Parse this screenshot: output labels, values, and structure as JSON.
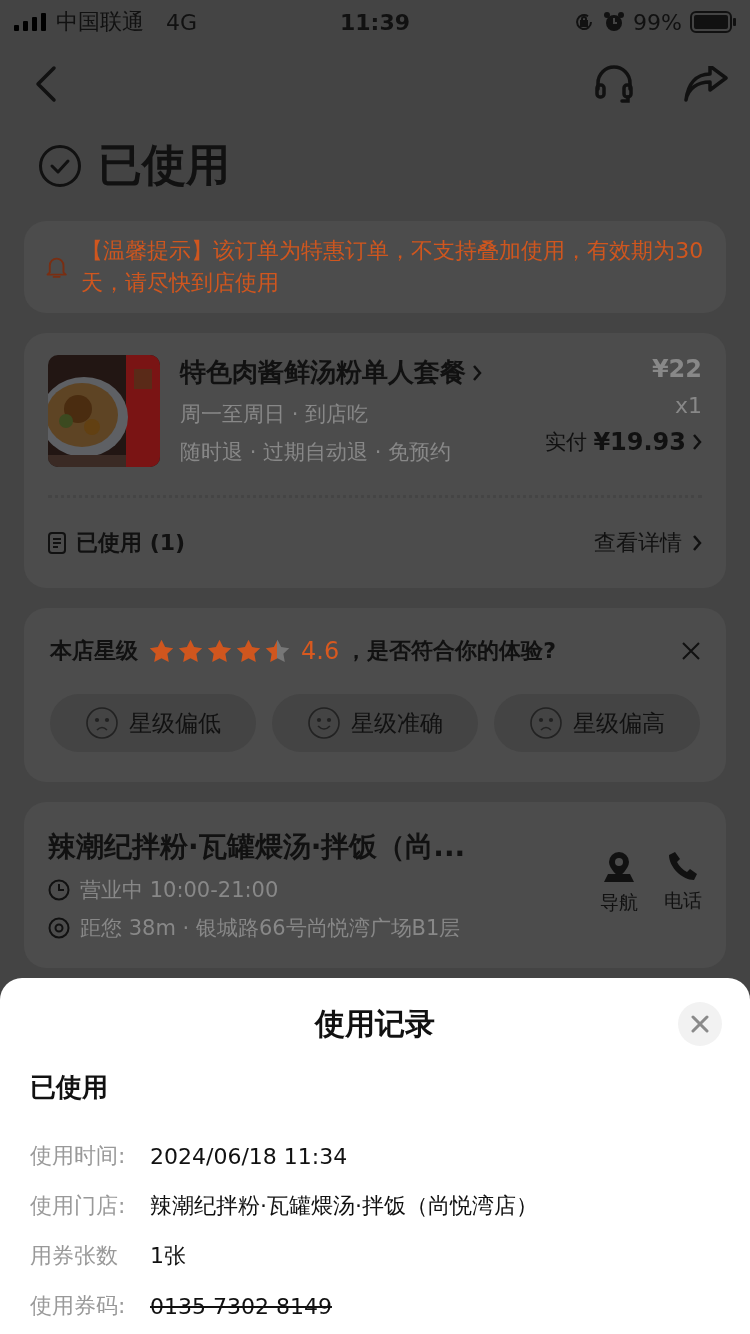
{
  "status_bar": {
    "carrier": "中国联通",
    "network": "4G",
    "time": "11:39",
    "battery": "99%"
  },
  "header": {
    "title": "已使用"
  },
  "notice": {
    "text": "【温馨提示】该订单为特惠订单，不支持叠加使用，有效期为30天，请尽快到店使用"
  },
  "product": {
    "name": "特色肉酱鲜汤粉单人套餐",
    "schedule": "周一至周日 · 到店吃",
    "policy": "随时退 · 过期自动退 · 免预约",
    "price": "¥22",
    "quantity": "x1",
    "paid_label": "实付",
    "paid": "¥19.93"
  },
  "usage": {
    "label": "已使用 (1)",
    "link": "查看详情"
  },
  "rating": {
    "label": "本店星级",
    "stars": 4.5,
    "score": "4.6",
    "question": "，是否符合你的体验?",
    "options": [
      {
        "label": "星级偏低",
        "kind": "sad"
      },
      {
        "label": "星级准确",
        "kind": "smile"
      },
      {
        "label": "星级偏高",
        "kind": "sad"
      }
    ]
  },
  "shop": {
    "name": "辣潮纪拌粉·瓦罐煨汤·拌饭（尚...",
    "hours": "营业中 10:00-21:00",
    "address": "距您 38m · 银城路66号尚悦湾广场B1层",
    "actions": [
      {
        "label": "导航",
        "kind": "nav"
      },
      {
        "label": "电话",
        "kind": "phone"
      }
    ]
  },
  "sheet": {
    "title": "使用记录",
    "status": "已使用",
    "fields": [
      {
        "label": "使用时间:",
        "value": "2024/06/18 11:34",
        "struck": false
      },
      {
        "label": "使用门店:",
        "value": "辣潮纪拌粉·瓦罐煨汤·拌饭（尚悦湾店）",
        "struck": false
      },
      {
        "label": "用券张数",
        "value": "1张",
        "struck": false
      },
      {
        "label": "使用券码:",
        "value": "0135 7302 8149",
        "struck": true
      }
    ]
  }
}
